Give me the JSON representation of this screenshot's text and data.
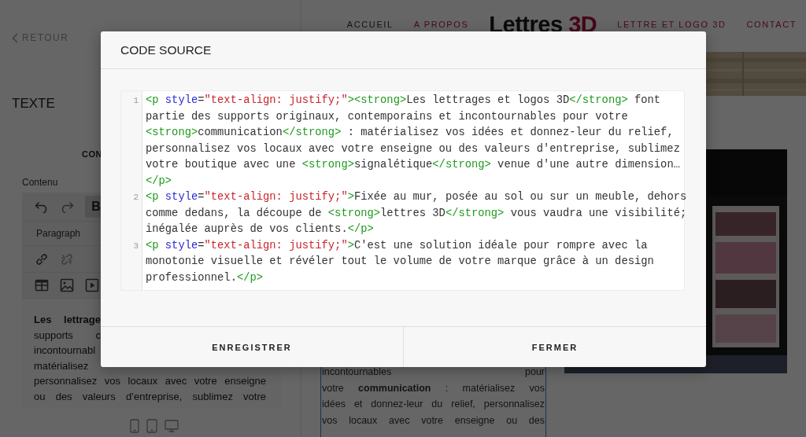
{
  "editor_panel": {
    "back_link": "RETOUR",
    "title": "TEXTE",
    "tab": "CON",
    "field_label": "Contenu",
    "bold_button": {
      "label": "B",
      "active": true
    },
    "block_format": "Paragraph",
    "content_lines": [
      {
        "text": "Les lettrage",
        "bold": true,
        "clipped": true
      },
      {
        "text": "supports c",
        "bold": false,
        "clipped": true
      },
      {
        "text": "incontournabl",
        "bold": false,
        "clipped": true
      },
      {
        "text": "matérialisez",
        "bold": false,
        "clipped": true
      },
      {
        "text": "personnalisez vos locaux avec votre enseigne",
        "bold": false,
        "clipped": false
      },
      {
        "text": "ou des valeurs d’entreprise, sublimez votre",
        "bold": false,
        "clipped": false
      }
    ]
  },
  "site": {
    "nav_left": [
      {
        "label": "ACCUEIL",
        "selected": true
      },
      {
        "label": "A PROPOS",
        "selected": false
      }
    ],
    "logo": {
      "text": "Lettres",
      "accent": "3D"
    },
    "nav_right": [
      {
        "label": "LETTRE ET LOGO 3D",
        "selected": false
      },
      {
        "label": "CONTACT",
        "selected": false
      }
    ],
    "hero": {
      "kind": "picture"
    },
    "text_lines": [
      "incontournables pour",
      "votre **communication** : matérialisez vos",
      "idées et donnez-leur du relief, personnalisez",
      "vos locaux avec votre enseigne ou des"
    ],
    "photo": {
      "kind": "picture"
    }
  },
  "modal": {
    "title": "CODE SOURCE",
    "code": [
      {
        "number": "1",
        "rows": [
          {
            "tokens": [
              {
                "kind": "tag",
                "text": "<p "
              },
              {
                "kind": "attr",
                "text": "style"
              },
              {
                "kind": "text",
                "text": "="
              },
              {
                "kind": "string",
                "text": "\"text-align: justify;\""
              },
              {
                "kind": "tag",
                "text": "><strong>"
              },
              {
                "kind": "text",
                "text": "Les lettrages et logos 3D"
              },
              {
                "kind": "tag",
                "text": "</strong>"
              },
              {
                "kind": "text",
                "text": " font"
              }
            ]
          },
          {
            "tokens": [
              {
                "kind": "text",
                "text": "partie des supports originaux, contemporains et incontournables pour votre"
              }
            ]
          },
          {
            "tokens": [
              {
                "kind": "tag",
                "text": "<strong>"
              },
              {
                "kind": "text",
                "text": "communication"
              },
              {
                "kind": "tag",
                "text": "</strong>"
              },
              {
                "kind": "text",
                "text": " : matérialisez vos idées et donnez-leur du relief,"
              }
            ]
          },
          {
            "tokens": [
              {
                "kind": "text",
                "text": "personnalisez vos locaux avec votre enseigne ou des valeurs d'entreprise, sublimez"
              }
            ]
          },
          {
            "tokens": [
              {
                "kind": "text",
                "text": "votre boutique avec une "
              },
              {
                "kind": "tag",
                "text": "<strong>"
              },
              {
                "kind": "text",
                "text": "signalétique"
              },
              {
                "kind": "tag",
                "text": "</strong>"
              },
              {
                "kind": "text",
                "text": " venue d'une autre dimension…"
              }
            ]
          },
          {
            "tokens": [
              {
                "kind": "tag",
                "text": "</p>"
              }
            ]
          }
        ]
      },
      {
        "number": "2",
        "rows": [
          {
            "tokens": [
              {
                "kind": "tag",
                "text": "<p "
              },
              {
                "kind": "attr",
                "text": "style"
              },
              {
                "kind": "text",
                "text": "="
              },
              {
                "kind": "string",
                "text": "\"text-align: justify;\""
              },
              {
                "kind": "tag",
                "text": ">"
              },
              {
                "kind": "text",
                "text": "Fixée au mur, posée au sol ou sur un meuble, dehors"
              }
            ]
          },
          {
            "tokens": [
              {
                "kind": "text",
                "text": "comme dedans, la découpe de "
              },
              {
                "kind": "tag",
                "text": "<strong>"
              },
              {
                "kind": "text",
                "text": "lettres 3D"
              },
              {
                "kind": "tag",
                "text": "</strong>"
              },
              {
                "kind": "text",
                "text": " vous vaudra une visibilité;"
              }
            ]
          },
          {
            "tokens": [
              {
                "kind": "text",
                "text": "inégalée auprès de vos clients."
              },
              {
                "kind": "tag",
                "text": "</p>"
              }
            ]
          }
        ]
      },
      {
        "number": "3",
        "rows": [
          {
            "tokens": [
              {
                "kind": "tag",
                "text": "<p "
              },
              {
                "kind": "attr",
                "text": "style"
              },
              {
                "kind": "text",
                "text": "="
              },
              {
                "kind": "string",
                "text": "\"text-align: justify;\""
              },
              {
                "kind": "tag",
                "text": ">"
              },
              {
                "kind": "text",
                "text": "C'est une solution idéale pour rompre avec la"
              }
            ]
          },
          {
            "tokens": [
              {
                "kind": "text",
                "text": "monotonie visuelle et révéler tout le volume de votre marque grâce à un design"
              }
            ]
          },
          {
            "tokens": [
              {
                "kind": "text",
                "text": "professionnel."
              },
              {
                "kind": "tag",
                "text": "</p>"
              }
            ]
          }
        ]
      }
    ],
    "buttons": [
      "ENREGISTRER",
      "FERMER"
    ]
  }
}
